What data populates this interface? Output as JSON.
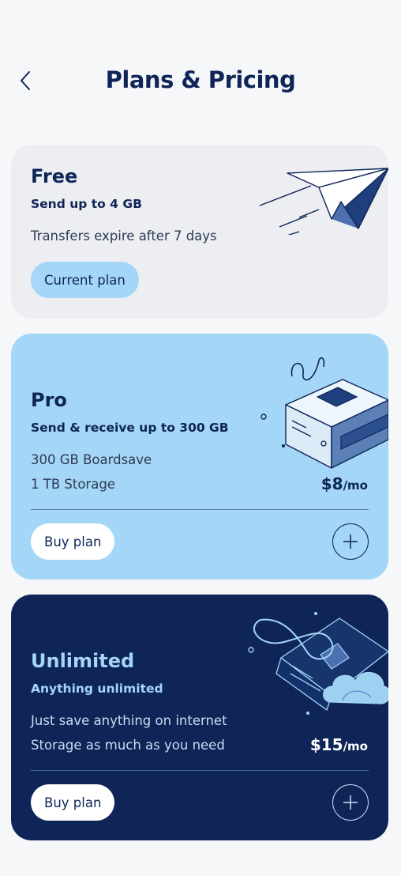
{
  "header": {
    "title": "Plans & Pricing",
    "back_icon": "chevron-left-icon"
  },
  "plans": [
    {
      "name": "Free",
      "subtitle": "Send up to 4 GB",
      "features": [
        "Transfers expire after 7 days"
      ],
      "button_label": "Current plan",
      "illustration": "paper-plane-illustration"
    },
    {
      "name": "Pro",
      "subtitle": "Send & receive up to 300 GB",
      "features": [
        "300 GB Boardsave",
        "1 TB Storage"
      ],
      "price": "$8",
      "price_unit": "/mo",
      "button_label": "Buy plan",
      "expand_icon": "plus-icon",
      "illustration": "storage-box-illustration"
    },
    {
      "name": "Unlimited",
      "subtitle": "Anything unlimited",
      "features": [
        "Just save anything on internet",
        "Storage as much as you need"
      ],
      "price": "$15",
      "price_unit": "/mo",
      "button_label": "Buy plan",
      "expand_icon": "plus-icon",
      "illustration": "cloud-storage-illustration"
    }
  ],
  "colors": {
    "navy": "#0f2557",
    "light_blue": "#a3d6f7",
    "gray_card": "#eceef1",
    "background": "#f6f7f9"
  }
}
